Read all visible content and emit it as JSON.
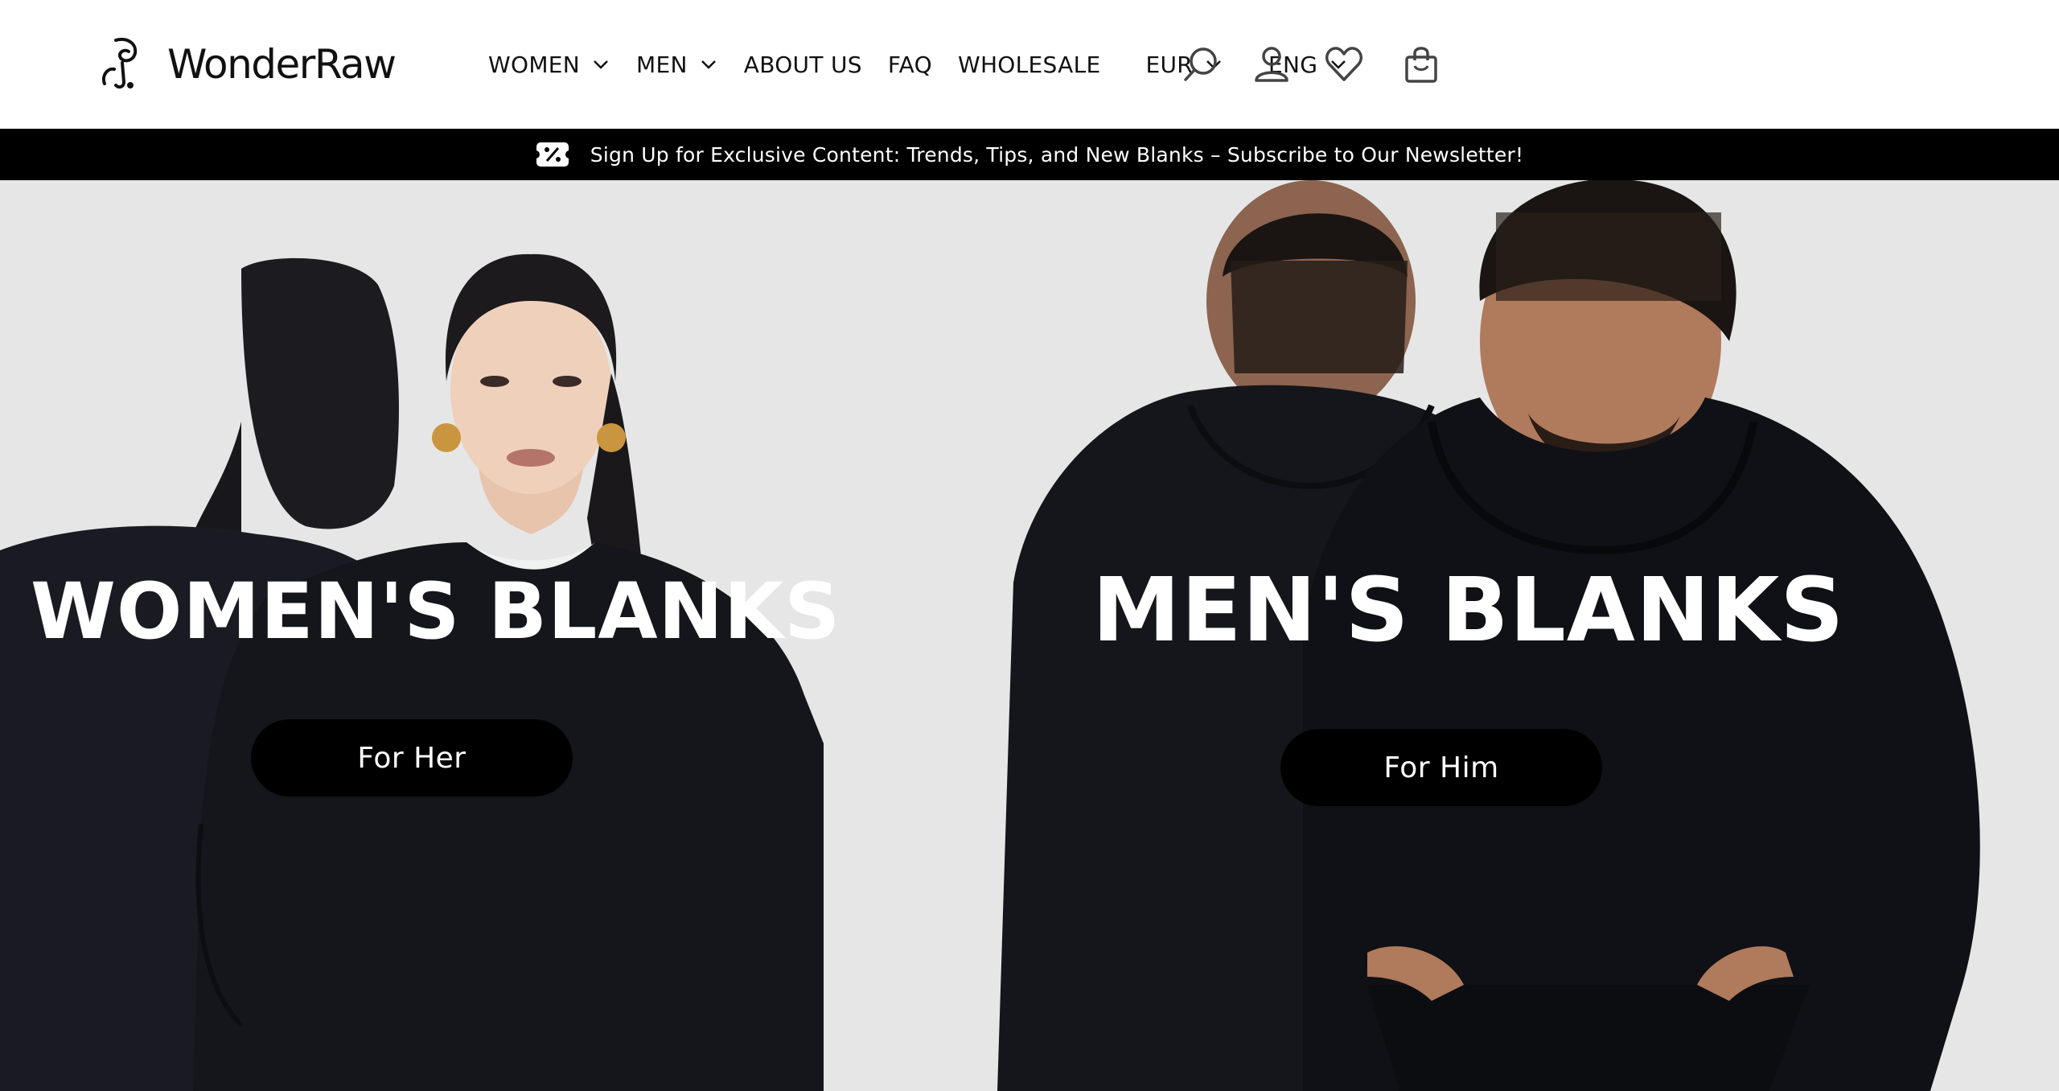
{
  "header": {
    "logo_text": "WonderRaw",
    "nav": [
      {
        "label": "WOMEN",
        "dropdown": true
      },
      {
        "label": "MEN",
        "dropdown": true
      },
      {
        "label": "ABOUT US",
        "dropdown": false
      },
      {
        "label": "FAQ",
        "dropdown": false
      },
      {
        "label": "WHOLESALE",
        "dropdown": false
      }
    ],
    "currency": "EUR",
    "language": "ENG",
    "icons": [
      "search-icon",
      "account-icon",
      "wishlist-icon",
      "cart-icon"
    ]
  },
  "announcement": {
    "icon": "discount-tag-icon",
    "text": "Sign Up for Exclusive Content: Trends, Tips, and New Blanks – Subscribe to Our Newsletter!"
  },
  "hero": {
    "women": {
      "title": "WOMEN'S BLANKS",
      "button": "For Her"
    },
    "men": {
      "title": "MEN'S BLANKS",
      "button": "For Him"
    }
  },
  "colors": {
    "header_bg": "#ffffff",
    "announcement_bg": "#000000",
    "hero_bg": "#e6e6e6",
    "button_bg": "#000000",
    "garment": "#15161c"
  }
}
